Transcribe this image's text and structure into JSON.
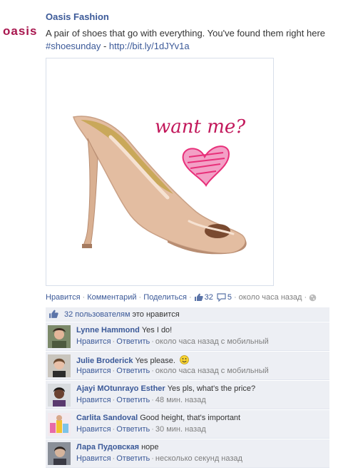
{
  "brand": {
    "logo_text": "oasis",
    "logo_color": "#a8164e"
  },
  "post": {
    "author": "Oasis Fashion",
    "text_line1": "A pair of shoes that go with everything. You've found them right here",
    "hashtag": "#shoesunday",
    "dash": " - ",
    "link": "http://bit.ly/1dJYv1a",
    "photo_caption": "want me?"
  },
  "actions": {
    "like": "Нравится",
    "comment": "Комментарий",
    "share": "Поделиться",
    "likes_count": "32",
    "comments_count": "5",
    "time": "около часа назад",
    "privacy_icon": "globe-icon"
  },
  "likes_summary": {
    "count_text": "32 пользователям",
    "suffix": "это нравится"
  },
  "comments": [
    {
      "name": "Lynne Hammond",
      "text": "Yes I do!",
      "like": "Нравится",
      "reply": "Ответить",
      "meta": "около часа назад с мобильный"
    },
    {
      "name": "Julie Broderick",
      "text": "Yes please.",
      "like": "Нравится",
      "reply": "Ответить",
      "meta": "около часа назад с мобильный",
      "emoji": "smiley-icon"
    },
    {
      "name": "Ajayi MOtunrayo Esther",
      "text": "Yes pls, what's the price?",
      "like": "Нравится",
      "reply": "Ответить",
      "meta": "48 мин. назад"
    },
    {
      "name": "Carlita Sandoval",
      "text": "Good height, that's important",
      "like": "Нравится",
      "reply": "Ответить",
      "meta": "30 мин. назад"
    },
    {
      "name": "Лара Пудовская",
      "text": "норе",
      "like": "Нравится",
      "reply": "Ответить",
      "meta": "несколько секунд назад"
    }
  ],
  "colors": {
    "link": "#3b5998",
    "comment_bg": "#edeff4",
    "heart": "#e8307a"
  }
}
